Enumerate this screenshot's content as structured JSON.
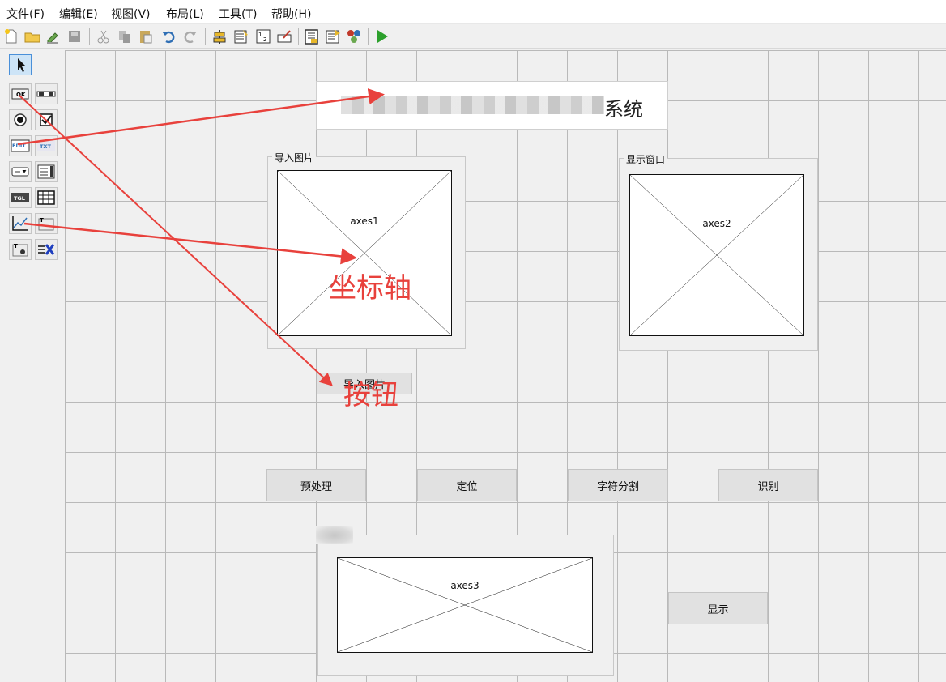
{
  "menu": {
    "file": "文件(F)",
    "edit": "编辑(E)",
    "view": "视图(V)",
    "layout": "布局(L)",
    "tools": "工具(T)",
    "help": "帮助(H)"
  },
  "toolbar": {
    "icons": [
      "new-file-icon",
      "open-folder-icon",
      "edit-icon",
      "save-icon",
      "cut-icon",
      "copy-icon",
      "paste-icon",
      "undo-icon",
      "redo-icon",
      "align-icon",
      "menu-editor-icon",
      "tab-order-icon",
      "toolbar-editor-icon",
      "m-file-icon",
      "property-inspector-icon",
      "object-browser-icon",
      "run-icon"
    ]
  },
  "palette": {
    "icons": [
      "select-arrow-icon",
      "push-button-icon",
      "slider-icon",
      "radio-button-icon",
      "checkbox-icon",
      "edit-text-icon",
      "static-text-icon",
      "popup-menu-icon",
      "listbox-icon",
      "toggle-button-icon",
      "table-icon",
      "axes-icon",
      "panel-icon",
      "button-group-icon",
      "activex-icon"
    ],
    "labels": {
      "push": "OK",
      "edit": "EDIT",
      "static": "TXT",
      "toggle": "TGL"
    }
  },
  "title": {
    "suffix": "系统"
  },
  "panels": {
    "import": {
      "title": "导入图片",
      "axes_label": "axes1"
    },
    "display": {
      "title": "显示窗口",
      "axes_label": "axes2"
    },
    "bottom": {
      "axes_label": "axes3"
    }
  },
  "buttons": {
    "import": "导入图片",
    "preprocess": "预处理",
    "locate": "定位",
    "segment": "字符分割",
    "recognize": "识别",
    "show": "显示"
  },
  "annotations": {
    "axes": "坐标轴",
    "button": "按钮"
  },
  "colors": {
    "annotation": "#e8413c",
    "run": "#2ca02c"
  }
}
